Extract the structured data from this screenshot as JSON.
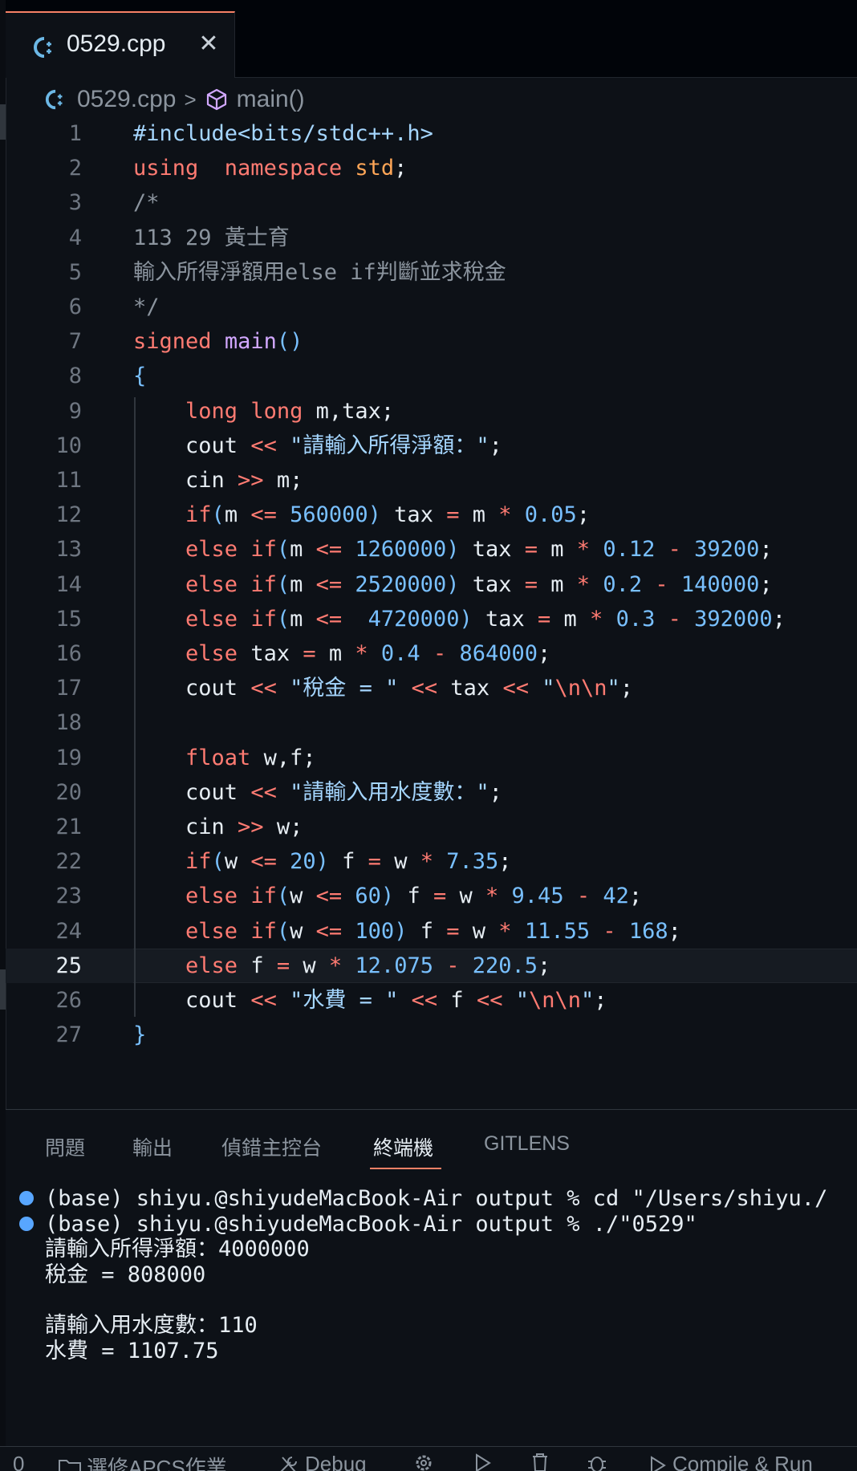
{
  "tab": {
    "filename": "0529.cpp",
    "close_glyph": "✕"
  },
  "breadcrumb": {
    "file": "0529.cpp",
    "separator": ">",
    "symbol": "main()"
  },
  "editor": {
    "current_line": 25,
    "lines": [
      [
        [
          "inc",
          "#include"
        ],
        [
          "str",
          "<bits/stdc++.h>"
        ]
      ],
      [
        [
          "kw",
          "using"
        ],
        [
          "",
          "  "
        ],
        [
          "kw",
          "namespace"
        ],
        [
          "",
          " "
        ],
        [
          "ns",
          "std"
        ],
        [
          "",
          ";"
        ]
      ],
      [
        [
          "cm",
          "/*"
        ]
      ],
      [
        [
          "cm",
          "113 29 黃士育"
        ]
      ],
      [
        [
          "cm",
          "輸入所得淨額用else if判斷並求稅金"
        ]
      ],
      [
        [
          "cm",
          "*/"
        ]
      ],
      [
        [
          "kw",
          "signed"
        ],
        [
          "",
          " "
        ],
        [
          "fn",
          "main"
        ],
        [
          "br",
          "()"
        ]
      ],
      [
        [
          "br",
          "{"
        ]
      ],
      [
        [
          "",
          "    "
        ],
        [
          "ty",
          "long"
        ],
        [
          "",
          " "
        ],
        [
          "ty",
          "long"
        ],
        [
          "",
          " m,tax;"
        ]
      ],
      [
        [
          "",
          "    cout "
        ],
        [
          "op",
          "<<"
        ],
        [
          "",
          " "
        ],
        [
          "str",
          "\"請輸入所得淨額："
        ],
        [
          "str",
          "\""
        ],
        [
          "",
          ";"
        ]
      ],
      [
        [
          "",
          "    cin "
        ],
        [
          "op",
          ">>"
        ],
        [
          "",
          " m;"
        ]
      ],
      [
        [
          "",
          "    "
        ],
        [
          "kw",
          "if"
        ],
        [
          "br",
          "("
        ],
        [
          "",
          "m "
        ],
        [
          "op",
          "<="
        ],
        [
          "",
          " "
        ],
        [
          "num",
          "560000"
        ],
        [
          "br",
          ")"
        ],
        [
          "",
          " tax "
        ],
        [
          "op",
          "="
        ],
        [
          "",
          " m "
        ],
        [
          "op",
          "*"
        ],
        [
          "",
          " "
        ],
        [
          "num",
          "0.05"
        ],
        [
          "",
          ";"
        ]
      ],
      [
        [
          "",
          "    "
        ],
        [
          "kw",
          "else"
        ],
        [
          "",
          " "
        ],
        [
          "kw",
          "if"
        ],
        [
          "br",
          "("
        ],
        [
          "",
          "m "
        ],
        [
          "op",
          "<="
        ],
        [
          "",
          " "
        ],
        [
          "num",
          "1260000"
        ],
        [
          "br",
          ")"
        ],
        [
          "",
          " tax "
        ],
        [
          "op",
          "="
        ],
        [
          "",
          " m "
        ],
        [
          "op",
          "*"
        ],
        [
          "",
          " "
        ],
        [
          "num",
          "0.12"
        ],
        [
          "",
          " "
        ],
        [
          "op",
          "-"
        ],
        [
          "",
          " "
        ],
        [
          "num",
          "39200"
        ],
        [
          "",
          ";"
        ]
      ],
      [
        [
          "",
          "    "
        ],
        [
          "kw",
          "else"
        ],
        [
          "",
          " "
        ],
        [
          "kw",
          "if"
        ],
        [
          "br",
          "("
        ],
        [
          "",
          "m "
        ],
        [
          "op",
          "<="
        ],
        [
          "",
          " "
        ],
        [
          "num",
          "2520000"
        ],
        [
          "br",
          ")"
        ],
        [
          "",
          " tax "
        ],
        [
          "op",
          "="
        ],
        [
          "",
          " m "
        ],
        [
          "op",
          "*"
        ],
        [
          "",
          " "
        ],
        [
          "num",
          "0.2"
        ],
        [
          "",
          " "
        ],
        [
          "op",
          "-"
        ],
        [
          "",
          " "
        ],
        [
          "num",
          "140000"
        ],
        [
          "",
          ";"
        ]
      ],
      [
        [
          "",
          "    "
        ],
        [
          "kw",
          "else"
        ],
        [
          "",
          " "
        ],
        [
          "kw",
          "if"
        ],
        [
          "br",
          "("
        ],
        [
          "",
          "m "
        ],
        [
          "op",
          "<="
        ],
        [
          "",
          "  "
        ],
        [
          "num",
          "4720000"
        ],
        [
          "br",
          ")"
        ],
        [
          "",
          " tax "
        ],
        [
          "op",
          "="
        ],
        [
          "",
          " m "
        ],
        [
          "op",
          "*"
        ],
        [
          "",
          " "
        ],
        [
          "num",
          "0.3"
        ],
        [
          "",
          " "
        ],
        [
          "op",
          "-"
        ],
        [
          "",
          " "
        ],
        [
          "num",
          "392000"
        ],
        [
          "",
          ";"
        ]
      ],
      [
        [
          "",
          "    "
        ],
        [
          "kw",
          "else"
        ],
        [
          "",
          " tax "
        ],
        [
          "op",
          "="
        ],
        [
          "",
          " m "
        ],
        [
          "op",
          "*"
        ],
        [
          "",
          " "
        ],
        [
          "num",
          "0.4"
        ],
        [
          "",
          " "
        ],
        [
          "op",
          "-"
        ],
        [
          "",
          " "
        ],
        [
          "num",
          "864000"
        ],
        [
          "",
          ";"
        ]
      ],
      [
        [
          "",
          "    cout "
        ],
        [
          "op",
          "<<"
        ],
        [
          "",
          " "
        ],
        [
          "str",
          "\"稅金 = \""
        ],
        [
          "",
          " "
        ],
        [
          "op",
          "<<"
        ],
        [
          "",
          " tax "
        ],
        [
          "op",
          "<<"
        ],
        [
          "",
          " "
        ],
        [
          "str",
          "\""
        ],
        [
          "esc",
          "\\n\\n"
        ],
        [
          "str",
          "\""
        ],
        [
          "",
          ";"
        ]
      ],
      [],
      [
        [
          "",
          "    "
        ],
        [
          "ty",
          "float"
        ],
        [
          "",
          " w,f;"
        ]
      ],
      [
        [
          "",
          "    cout "
        ],
        [
          "op",
          "<<"
        ],
        [
          "",
          " "
        ],
        [
          "str",
          "\"請輸入用水度數："
        ],
        [
          "str",
          "\""
        ],
        [
          "",
          ";"
        ]
      ],
      [
        [
          "",
          "    cin "
        ],
        [
          "op",
          ">>"
        ],
        [
          "",
          " w;"
        ]
      ],
      [
        [
          "",
          "    "
        ],
        [
          "kw",
          "if"
        ],
        [
          "br",
          "("
        ],
        [
          "",
          "w "
        ],
        [
          "op",
          "<="
        ],
        [
          "",
          " "
        ],
        [
          "num",
          "20"
        ],
        [
          "br",
          ")"
        ],
        [
          "",
          " f "
        ],
        [
          "op",
          "="
        ],
        [
          "",
          " w "
        ],
        [
          "op",
          "*"
        ],
        [
          "",
          " "
        ],
        [
          "num",
          "7.35"
        ],
        [
          "",
          ";"
        ]
      ],
      [
        [
          "",
          "    "
        ],
        [
          "kw",
          "else"
        ],
        [
          "",
          " "
        ],
        [
          "kw",
          "if"
        ],
        [
          "br",
          "("
        ],
        [
          "",
          "w "
        ],
        [
          "op",
          "<="
        ],
        [
          "",
          " "
        ],
        [
          "num",
          "60"
        ],
        [
          "br",
          ")"
        ],
        [
          "",
          " f "
        ],
        [
          "op",
          "="
        ],
        [
          "",
          " w "
        ],
        [
          "op",
          "*"
        ],
        [
          "",
          " "
        ],
        [
          "num",
          "9.45"
        ],
        [
          "",
          " "
        ],
        [
          "op",
          "-"
        ],
        [
          "",
          " "
        ],
        [
          "num",
          "42"
        ],
        [
          "",
          ";"
        ]
      ],
      [
        [
          "",
          "    "
        ],
        [
          "kw",
          "else"
        ],
        [
          "",
          " "
        ],
        [
          "kw",
          "if"
        ],
        [
          "br",
          "("
        ],
        [
          "",
          "w "
        ],
        [
          "op",
          "<="
        ],
        [
          "",
          " "
        ],
        [
          "num",
          "100"
        ],
        [
          "br",
          ")"
        ],
        [
          "",
          " f "
        ],
        [
          "op",
          "="
        ],
        [
          "",
          " w "
        ],
        [
          "op",
          "*"
        ],
        [
          "",
          " "
        ],
        [
          "num",
          "11.55"
        ],
        [
          "",
          " "
        ],
        [
          "op",
          "-"
        ],
        [
          "",
          " "
        ],
        [
          "num",
          "168"
        ],
        [
          "",
          ";"
        ]
      ],
      [
        [
          "",
          "    "
        ],
        [
          "kw",
          "else"
        ],
        [
          "",
          " f "
        ],
        [
          "op",
          "="
        ],
        [
          "",
          " w "
        ],
        [
          "op",
          "*"
        ],
        [
          "",
          " "
        ],
        [
          "num",
          "12.075"
        ],
        [
          "",
          " "
        ],
        [
          "op",
          "-"
        ],
        [
          "",
          " "
        ],
        [
          "num",
          "220.5"
        ],
        [
          "",
          ";"
        ]
      ],
      [
        [
          "",
          "    cout "
        ],
        [
          "op",
          "<<"
        ],
        [
          "",
          " "
        ],
        [
          "str",
          "\"水費 = \""
        ],
        [
          "",
          " "
        ],
        [
          "op",
          "<<"
        ],
        [
          "",
          " f "
        ],
        [
          "op",
          "<<"
        ],
        [
          "",
          " "
        ],
        [
          "str",
          "\""
        ],
        [
          "esc",
          "\\n\\n"
        ],
        [
          "str",
          "\""
        ],
        [
          "",
          ";"
        ]
      ],
      [
        [
          "br",
          "}"
        ]
      ]
    ]
  },
  "panel": {
    "tabs": [
      "問題",
      "輸出",
      "偵錯主控台",
      "終端機",
      "GITLENS"
    ],
    "active_tab": "終端機",
    "terminal": [
      {
        "dot": true,
        "text": "(base) shiyu.@shiyudeMacBook-Air output % cd \"/Users/shiyu./"
      },
      {
        "dot": true,
        "text": "(base) shiyu.@shiyudeMacBook-Air output % ./\"0529\""
      },
      {
        "dot": false,
        "text": "請輸入所得淨額：4000000"
      },
      {
        "dot": false,
        "text": "稅金 = 808000"
      },
      {
        "dot": false,
        "text": ""
      },
      {
        "dot": false,
        "text": "請輸入用水度數：110"
      },
      {
        "dot": false,
        "text": "水費 = 1107.75"
      }
    ]
  },
  "statusbar": {
    "count": "0",
    "folder": "選修APCS作業",
    "debug": "Debug",
    "compile_run": "Compile & Run"
  },
  "colors": {
    "accent": "#f78166",
    "background": "#0d1117",
    "keyword": "#ff7b72",
    "number": "#79c0ff",
    "string": "#a5d6ff",
    "function": "#d2a8ff",
    "namespace": "#ffa657"
  }
}
